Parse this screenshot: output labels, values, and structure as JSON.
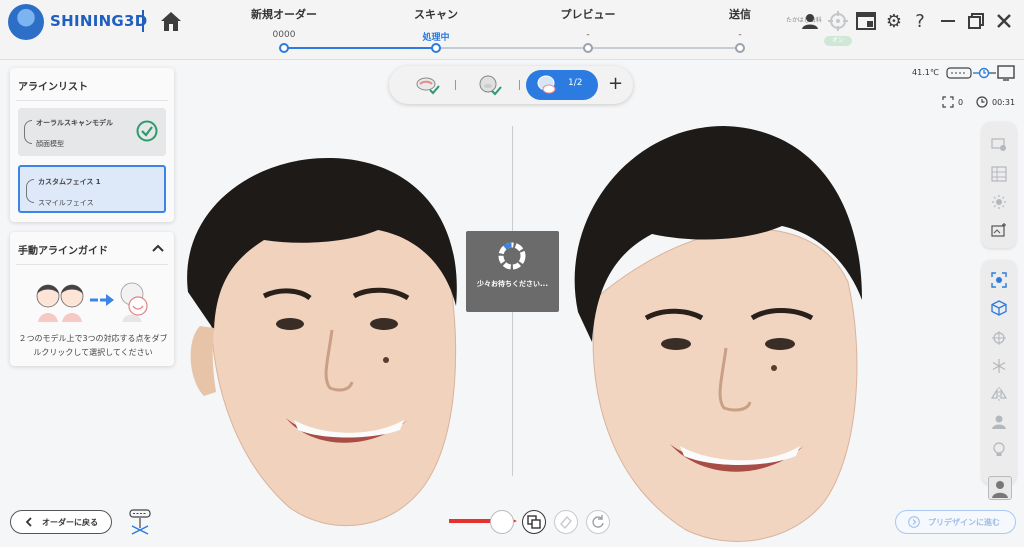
{
  "header": {
    "brand": "SHINING3D",
    "steps": [
      {
        "label": "新規オーダー",
        "value": "0000"
      },
      {
        "label": "スキャン",
        "value": "処理中"
      },
      {
        "label": "プレビュー",
        "value": "-"
      },
      {
        "label": "送信",
        "value": "-"
      }
    ],
    "user_name": "たかはし歯科",
    "badge_text": "オン",
    "colors": {
      "accent": "#2b7be0",
      "brand": "#1f5fbf"
    }
  },
  "align_list": {
    "title": "アラインリスト",
    "items": [
      {
        "line1": "オーラルスキャンモデル",
        "line2": "顔面模型",
        "status": "check-icon"
      },
      {
        "line1": "カスタムフェイス 1",
        "line2": "スマイルフェイス"
      }
    ]
  },
  "guide": {
    "title": "手動アラインガイド",
    "text": "２つのモデル上で3つの対応する点をダブルクリックして選択してください"
  },
  "toolbar": {
    "active_label": "1/2"
  },
  "status": {
    "temperature": "41.1℃",
    "count": "0",
    "timer": "00:31"
  },
  "loading": {
    "text": "少々お待ちください..."
  },
  "bottom": {
    "back_label": "オーダーに戻る",
    "next_label": "プリデザインに進む"
  }
}
